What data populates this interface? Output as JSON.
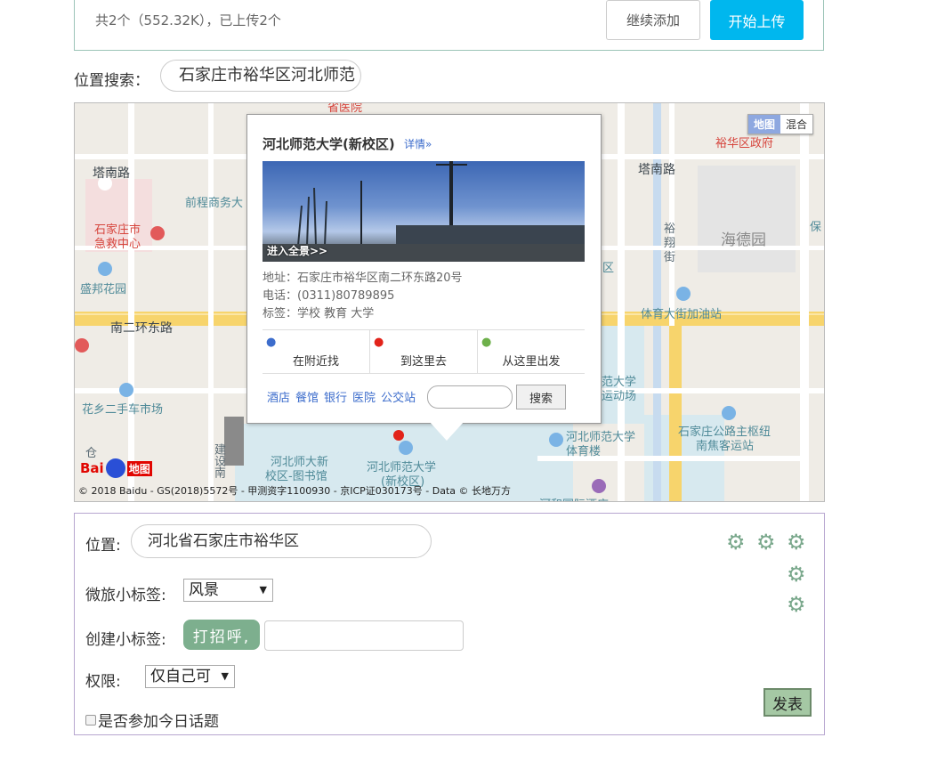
{
  "upload": {
    "summary": "共2个（552.32K），已上传2个",
    "continue_label": "继续添加",
    "start_label": "开始上传"
  },
  "location_search": {
    "label": "位置搜索：",
    "value": "石家庄市裕华区河北师范"
  },
  "map": {
    "type_map": "地图",
    "type_hybrid": "混合",
    "labels": {
      "hospital_top": "省医院",
      "yuhua_gov": "裕华区政府",
      "tanan_road_left": "塔南路",
      "tanan_road_right": "塔南路",
      "qiancheng": "前程商务大",
      "emergency_1": "石家庄市",
      "emergency_2": "急救中心",
      "yuxiang_1": "裕",
      "yuxiang_2": "翔",
      "yuxiang_3": "街",
      "haide": "海德园",
      "bao": "保",
      "shengbang": "盛邦花园",
      "district": "区",
      "ring_road": "南二环东路",
      "gas_station": "体育大街加油站",
      "flea_market": "花乡二手车市场",
      "hebei_univ_sports_field_1": "范大学",
      "hebei_univ_sports_field_2": "运动场",
      "gymnasium_1": "河北师范大学",
      "gymnasium_2": "体育楼",
      "bus_station_1": "石家庄公路主枢纽",
      "bus_station_2": "南焦客运站",
      "library_1": "河北师大新",
      "library_2": "校区-图书馆",
      "campus_1": "河北师范大学",
      "campus_2": "(新校区)",
      "jianshe": "建设南",
      "cang": "仓",
      "hotel": "河和国际酒店"
    },
    "copyright": "© 2018 Baidu - GS(2018)5572号 - 甲测资字1100930 - 京ICP证030173号 - Data © 长地万方",
    "logo_left": "Bai",
    "logo_right": "地图",
    "info": {
      "title": "河北师范大学(新校区)",
      "detail_link": "详情»",
      "pano_link": "进入全景>>",
      "address": "地址：石家庄市裕华区南二环东路20号",
      "phone": "电话：(0311)80789895",
      "tags": "标签：学校 教育 大学",
      "actions": [
        "在附近找",
        "到这里去",
        "从这里出发"
      ],
      "links": [
        "酒店",
        "餐馆",
        "银行",
        "医院",
        "公交站"
      ],
      "search_label": "搜索"
    }
  },
  "form": {
    "position_label": "位置:",
    "position_value": "河北省石家庄市裕华区",
    "micro_tag_label": "微旅小标签:",
    "micro_tag_value": "风景",
    "create_tag_label": "创建小标签:",
    "create_tag_chip": "打招呼,",
    "permission_label": "权限:",
    "permission_value": "仅自己可",
    "topic_label": "是否参加今日话题",
    "publish_label": "发表"
  },
  "colors": {
    "upload_button": "#00b7ee",
    "tag_chip": "#7daf8e",
    "publish_button": "#a5c8a4"
  }
}
